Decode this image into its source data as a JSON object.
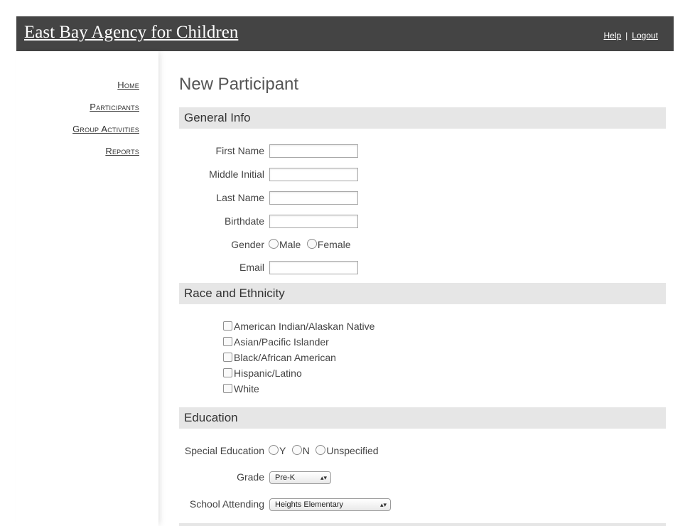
{
  "header": {
    "title": "East Bay Agency for Children",
    "help": "Help",
    "separator": "|",
    "logout": "Logout"
  },
  "nav": [
    "Home",
    "Participants",
    "Group Activities",
    "Reports"
  ],
  "page_title": "New Participant",
  "general_info": {
    "heading": "General Info",
    "first_name": "First Name",
    "middle_initial": "Middle Initial",
    "last_name": "Last Name",
    "birthdate": "Birthdate",
    "gender": "Gender",
    "gender_options": [
      "Male",
      "Female"
    ],
    "email": "Email"
  },
  "race": {
    "heading": "Race and Ethnicity",
    "options": [
      "American Indian/Alaskan Native",
      "Asian/Pacific Islander",
      "Black/African American",
      "Hispanic/Latino",
      "White"
    ]
  },
  "education": {
    "heading": "Education",
    "special_education": "Special Education",
    "special_options": [
      "Y",
      "N",
      "Unspecified"
    ],
    "grade_label": "Grade",
    "grade_value": "Pre-K",
    "school_label": "School Attending",
    "school_value": "Heights Elementary"
  }
}
